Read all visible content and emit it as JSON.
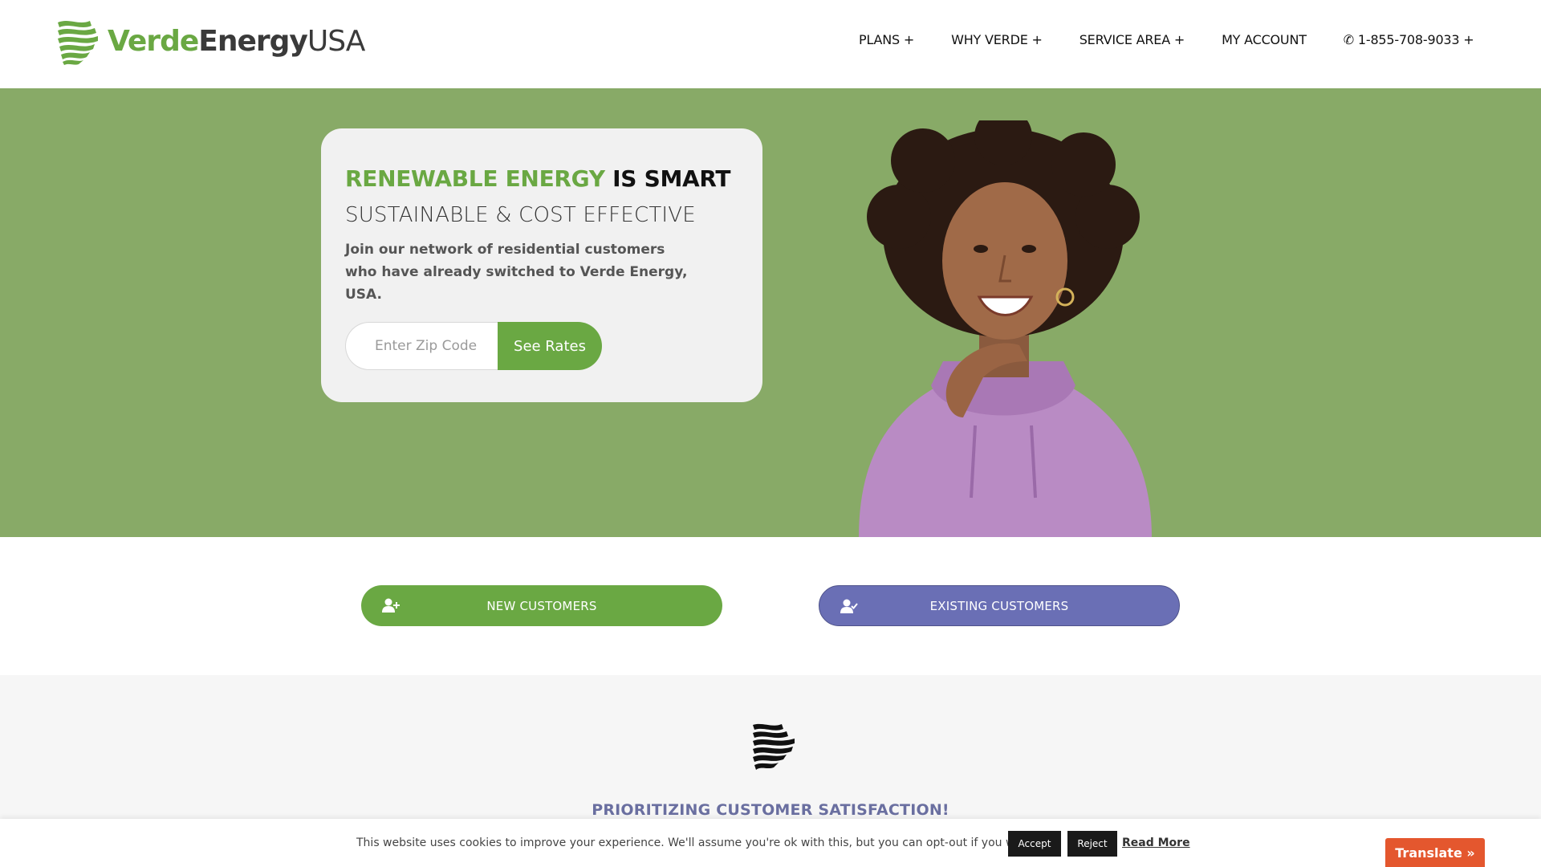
{
  "header": {
    "logo": {
      "verde": "Verde",
      "energy": "Energy",
      "usa": "USA"
    },
    "nav": [
      {
        "label": "PLANS +"
      },
      {
        "label": "WHY VERDE +"
      },
      {
        "label": "SERVICE AREA +"
      },
      {
        "label": "MY ACCOUNT"
      },
      {
        "label": "✆ 1-855-708-9033 +"
      }
    ]
  },
  "hero": {
    "headline_green": "RENEWABLE ENERGY",
    "headline_dark": " IS SMART",
    "subhead": "SUSTAINABLE & COST EFFECTIVE",
    "blurb": "Join our network of residential customers who have already switched to Verde Energy, USA.",
    "zip_placeholder": "Enter Zip Code",
    "zip_value": "",
    "cta_label": "See Rates"
  },
  "customer_buttons": {
    "new_label": "NEW CUSTOMERS",
    "existing_label": "EXISTING CUSTOMERS"
  },
  "feature": {
    "title": "PRIORITIZING CUSTOMER SATISFACTION!"
  },
  "cookie": {
    "text": "This website uses cookies to improve your experience. We'll assume you're ok with this, but you can opt-out if you wish.",
    "accept": "Accept",
    "reject": "Reject",
    "read_more": "Read More"
  },
  "translate": {
    "label": "Translate »"
  },
  "colors": {
    "brand_green": "#6aa843",
    "hero_bg": "#88aa67",
    "existing_purple": "#6a6fb5",
    "translate_orange": "#e4572e",
    "feature_title": "#6a6fa0"
  },
  "icons": {
    "logo_mark": "verde-leaf-stripes-icon",
    "new_customer": "user-plus-icon",
    "existing_customer": "user-check-icon",
    "feature": "verde-stripes-icon"
  }
}
